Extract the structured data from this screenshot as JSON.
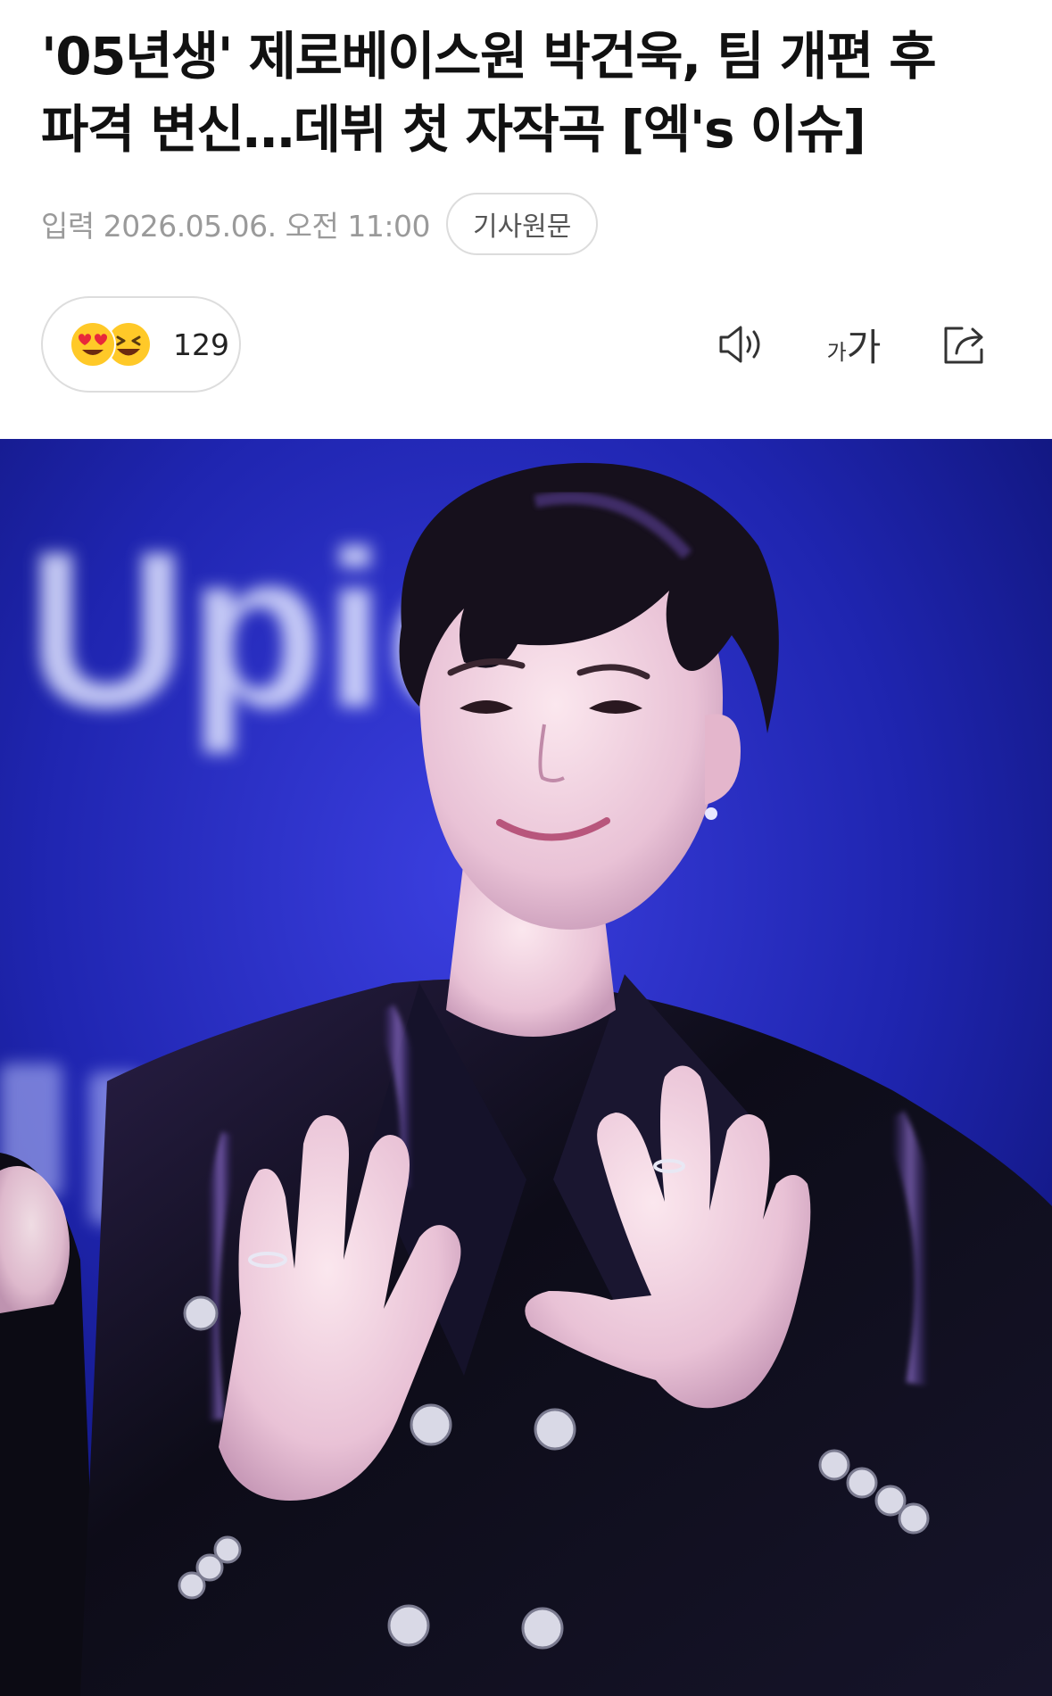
{
  "article": {
    "headline_line1": "'05년생' 제로베이스원 박건욱, 팀 개편 후",
    "headline_line2": "파격 변신…데뷔 첫 자작곡 [엑's 이슈]",
    "publish_info": "입력 2026.05.06. 오전 11:00",
    "original_article_label": "기사원문"
  },
  "reactions": {
    "count": "129",
    "emojis": [
      "heart-eyes-emoji",
      "laughing-emoji"
    ]
  },
  "toolbar": {
    "icons": [
      "speaker-icon",
      "font-size-icon",
      "share-icon"
    ],
    "font_size_small": "가",
    "font_size_big": "가"
  },
  "photo": {
    "backdrop_text": "Upic",
    "colors": {
      "background": "#1a1f9a",
      "jacket": "#0c0c14",
      "accent_purple": "#7a3cff"
    }
  }
}
